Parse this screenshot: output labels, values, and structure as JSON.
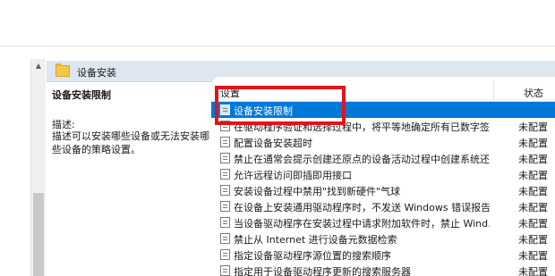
{
  "header": {
    "title": "设备安装"
  },
  "description": {
    "title": "设备安装限制",
    "label": "描述:",
    "body": "描述可以安装哪些设备或无法安装哪些设备的策略设置。"
  },
  "list": {
    "col_setting": "设置",
    "col_state": "状态",
    "rows": [
      {
        "label": "设备安装限制",
        "state": "",
        "selected": true
      },
      {
        "label": "在驱动程序验证和选择过程中，将平等地确定所有已数字签…",
        "state": "未配置"
      },
      {
        "label": "配置设备安装超时",
        "state": "未配置"
      },
      {
        "label": "禁止在通常会提示创建还原点的设备活动过程中创建系统还…",
        "state": "未配置"
      },
      {
        "label": "允许远程访问即插即用接口",
        "state": "未配置"
      },
      {
        "label": "安装设备过程中禁用\"找到新硬件\"气球",
        "state": "未配置"
      },
      {
        "label": "在设备上安装通用驱动程序时，不发送 Windows 错误报告",
        "state": "未配置"
      },
      {
        "label": "当设备驱动程序在安装过程中请求附加软件时，禁止 Wind…",
        "state": "未配置"
      },
      {
        "label": "禁止从 Internet 进行设备元数据检索",
        "state": "未配置"
      },
      {
        "label": "指定设备驱动程序源位置的搜索顺序",
        "state": "未配置"
      },
      {
        "label": "指定用于设备驱动程序更新的搜索服务器",
        "state": "未配置"
      }
    ]
  },
  "colors": {
    "selection": "#0078d7",
    "highlight": "#e0141c",
    "header_bg": "#dee6ef"
  },
  "icons": {
    "header": "folder-icon",
    "row": "policy-setting-icon"
  }
}
